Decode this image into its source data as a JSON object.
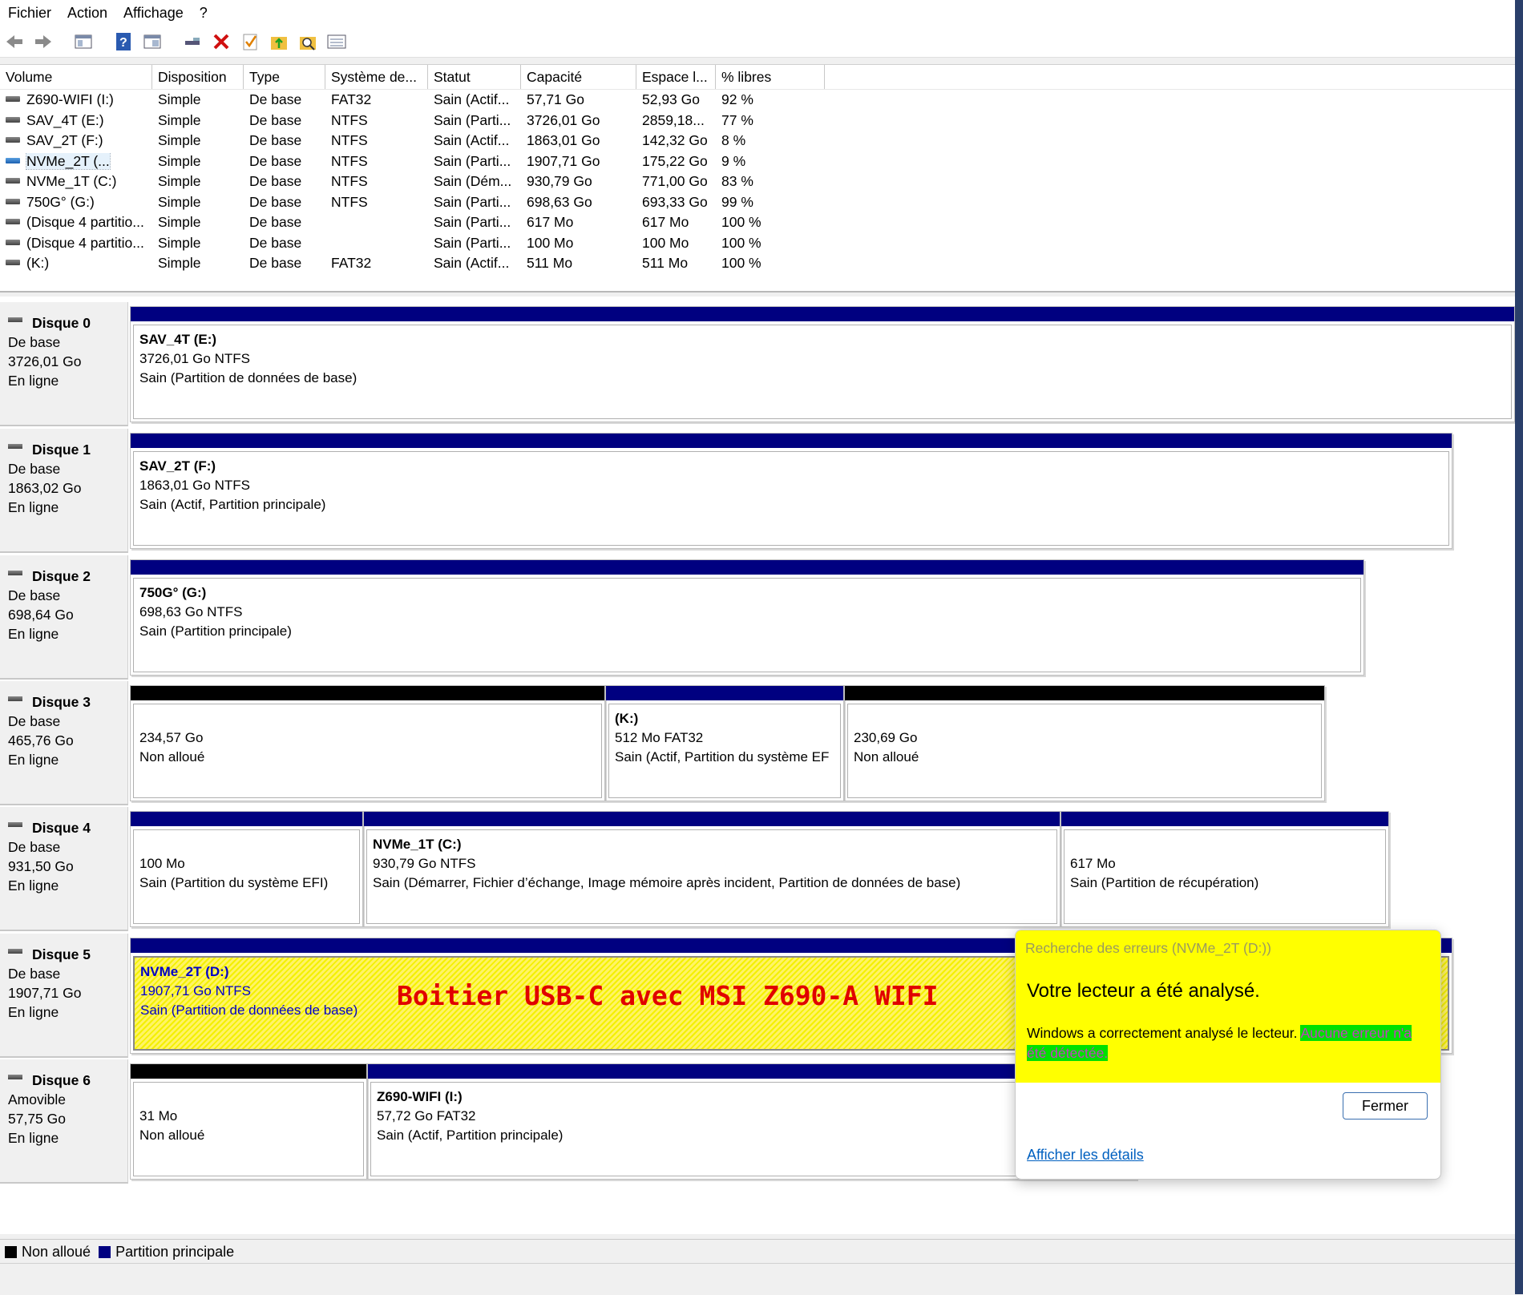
{
  "menu": [
    "Fichier",
    "Action",
    "Affichage",
    "?"
  ],
  "toolbar_icons": [
    "back-arrow-icon",
    "forward-arrow-icon",
    "console-tree-icon",
    "help-icon",
    "properties-icon",
    "connect-icon",
    "delete-icon",
    "check-icon",
    "folder-up-icon",
    "find-icon",
    "view-list-icon"
  ],
  "columns": [
    "Volume",
    "Disposition",
    "Type",
    "Système de...",
    "Statut",
    "Capacité",
    "Espace l...",
    "% libres"
  ],
  "volumes": [
    {
      "name": "Z690-WIFI (I:)",
      "layout": "Simple",
      "type": "De base",
      "fs": "FAT32",
      "status": "Sain (Actif...",
      "capacity": "57,71 Go",
      "free": "52,93 Go",
      "pct": "92 %"
    },
    {
      "name": "SAV_4T (E:)",
      "layout": "Simple",
      "type": "De base",
      "fs": "NTFS",
      "status": "Sain (Parti...",
      "capacity": "3726,01 Go",
      "free": "2859,18...",
      "pct": "77 %"
    },
    {
      "name": "SAV_2T (F:)",
      "layout": "Simple",
      "type": "De base",
      "fs": "NTFS",
      "status": "Sain (Actif...",
      "capacity": "1863,01 Go",
      "free": "142,32 Go",
      "pct": "8 %"
    },
    {
      "name": "NVMe_2T (...",
      "layout": "Simple",
      "type": "De base",
      "fs": "NTFS",
      "status": "Sain (Parti...",
      "capacity": "1907,71 Go",
      "free": "175,22 Go",
      "pct": "9 %"
    },
    {
      "name": "NVMe_1T (C:)",
      "layout": "Simple",
      "type": "De base",
      "fs": "NTFS",
      "status": "Sain (Dém...",
      "capacity": "930,79 Go",
      "free": "771,00 Go",
      "pct": "83 %"
    },
    {
      "name": "750G° (G:)",
      "layout": "Simple",
      "type": "De base",
      "fs": "NTFS",
      "status": "Sain (Parti...",
      "capacity": "698,63 Go",
      "free": "693,33 Go",
      "pct": "99 %"
    },
    {
      "name": "(Disque 4 partitio...",
      "layout": "Simple",
      "type": "De base",
      "fs": "",
      "status": "Sain (Parti...",
      "capacity": "617 Mo",
      "free": "617 Mo",
      "pct": "100 %"
    },
    {
      "name": "(Disque 4 partitio...",
      "layout": "Simple",
      "type": "De base",
      "fs": "",
      "status": "Sain (Parti...",
      "capacity": "100 Mo",
      "free": "100 Mo",
      "pct": "100 %"
    },
    {
      "name": "(K:)",
      "layout": "Simple",
      "type": "De base",
      "fs": "FAT32",
      "status": "Sain (Actif...",
      "capacity": "511 Mo",
      "free": "511 Mo",
      "pct": "100 %"
    }
  ],
  "disks": [
    {
      "name": "Disque 0",
      "type": "De base",
      "size": "3726,01 Go",
      "state": "En ligne",
      "partitions": [
        {
          "title": "SAV_4T  (E:)",
          "size": "3726,01 Go NTFS",
          "status": "Sain (Partition de données de base)"
        }
      ]
    },
    {
      "name": "Disque 1",
      "type": "De base",
      "size": "1863,02 Go",
      "state": "En ligne",
      "partitions": [
        {
          "title": "SAV_2T  (F:)",
          "size": "1863,01 Go NTFS",
          "status": "Sain (Actif, Partition principale)"
        }
      ]
    },
    {
      "name": "Disque 2",
      "type": "De base",
      "size": "698,64 Go",
      "state": "En ligne",
      "partitions": [
        {
          "title": "750G°  (G:)",
          "size": "698,63 Go NTFS",
          "status": "Sain (Partition principale)"
        }
      ]
    },
    {
      "name": "Disque 3",
      "type": "De base",
      "size": "465,76 Go",
      "state": "En ligne",
      "partitions": [
        {
          "title": "",
          "size": "234,57 Go",
          "status": "Non alloué"
        },
        {
          "title": "(K:)",
          "size": "512 Mo FAT32",
          "status": "Sain (Actif, Partition du système EF"
        },
        {
          "title": "",
          "size": "230,69 Go",
          "status": "Non alloué"
        }
      ]
    },
    {
      "name": "Disque 4",
      "type": "De base",
      "size": "931,50 Go",
      "state": "En ligne",
      "partitions": [
        {
          "title": "",
          "size": "100 Mo",
          "status": "Sain (Partition du système EFI)"
        },
        {
          "title": "NVMe_1T  (C:)",
          "size": "930,79 Go NTFS",
          "status": "Sain (Démarrer, Fichier d’échange, Image mémoire après incident, Partition de données de base)"
        },
        {
          "title": "",
          "size": "617 Mo",
          "status": "Sain (Partition de récupération)"
        }
      ]
    },
    {
      "name": "Disque 5",
      "type": "De base",
      "size": "1907,71 Go",
      "state": "En ligne",
      "partitions": [
        {
          "title": "NVMe_2T  (D:)",
          "size": "1907,71 Go NTFS",
          "status": "Sain (Partition de données de base)"
        }
      ]
    },
    {
      "name": "Disque 6",
      "type": "Amovible",
      "size": "57,75 Go",
      "state": "En ligne",
      "partitions": [
        {
          "title": "",
          "size": "31 Mo",
          "status": "Non alloué"
        },
        {
          "title": "Z690-WIFI  (I:)",
          "size": "57,72 Go FAT32",
          "status": "Sain (Actif, Partition principale)"
        }
      ]
    }
  ],
  "annotation": "Boitier USB-C avec MSI Z690-A WIFI",
  "legend": [
    {
      "label": "Non alloué",
      "color": "#000000"
    },
    {
      "label": "Partition principale",
      "color": "#000080"
    }
  ],
  "popup": {
    "title": "Recherche des erreurs (NVMe_2T (D:))",
    "heading": "Votre lecteur a été analysé.",
    "message": "Windows a correctement analysé le lecteur.",
    "highlight": "Aucune erreur n'a été détectée.",
    "close_label": "Fermer",
    "details_link": "Afficher les détails"
  },
  "colors": {
    "primary_partition": "#000080",
    "unallocated": "#000000",
    "highlight_yellow": "#ffff00",
    "highlight_green": "#00e000",
    "annotation_red": "#e00000"
  }
}
